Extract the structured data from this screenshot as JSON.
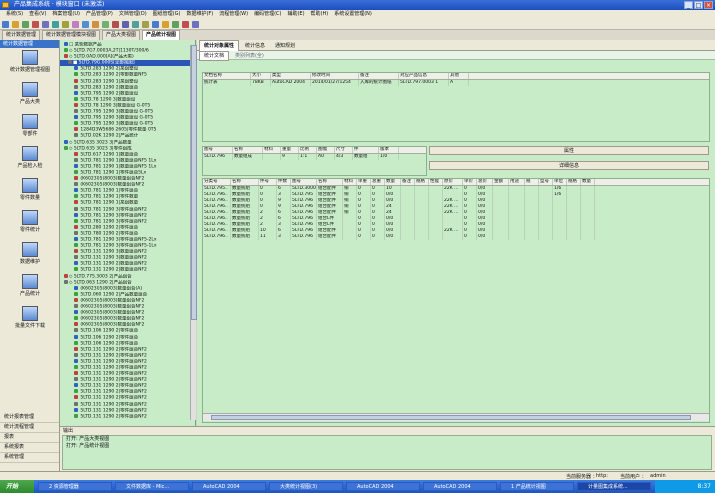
{
  "window": {
    "title": "产品集成系统 · 模块窗口 (未激活)",
    "icon": "app-icon"
  },
  "menu": [
    "系统(S)",
    "查看(V)",
    "档案管理(U)",
    "产品管理(P)",
    "文档管理(D)",
    "图纸管理(G)",
    "数据维护(F)",
    "流程管理(W)",
    "编码管理(C)",
    "辅助(E)",
    "帮助(H)",
    "系统设置管理(N)"
  ],
  "doc_tabs": [
    {
      "label": "统计数据管理"
    },
    {
      "label": "统计数据管理模块视图"
    },
    {
      "label": "产品大类视图"
    },
    {
      "label": "产品统计视图",
      "active": true
    }
  ],
  "left_panel": {
    "header": "统计数据管理",
    "items": [
      "统计数据管理视图",
      "产品大类",
      "零部件",
      "产品检入检",
      "零件数量",
      "零件统计",
      "数据维护",
      "产品统计",
      "批量文件下载"
    ],
    "bottom": [
      "统计报表管理",
      "统计流程管理",
      "报表",
      "系统报表",
      "系统管理"
    ]
  },
  "tree": {
    "rows": [
      "□ 某些数据产品",
      "◇ 5LTD.7G7.0003A,2T|1130T/300/6",
      "◇ 5LTD.0AD.000[A](产品大类)",
      "■ 5LTD.79G.000S[全部视图]",
      "  5LTD.283 1290 2|某组整设",
      "  5LTD.283 1290 2|零部数量NF5",
      "  5LTD.283 1290 1|某组整设",
      "  5LTD.283 1290 2|数量组合",
      "  5LTD.795 1290 2|数量组设",
      "  5LTD.78 1290 3|数量组设",
      "  5LTD.78 1290 3|数量组设 G-0T5",
      "  5LTD.795 1290 3|数量组设 G-0T5",
      "  5LTD.795 1290 3|数量组设 G-0T5",
      "  5LTD.795 1290 3|数量组设 G-0T5",
      "  1284D3W5686 2605|零件数量 0T5",
      "  5LTD.02K 1290 2|产品统计",
      "◇ 5LTD.635 3023 3|产品数量",
      "◇ 5LTD.635 3023 3|零件组成",
      "  5LTD.617 1290 1|数量组合",
      "  5LTD.781 1290 1|数量组合NF5 1Lx",
      "  5LTD.781 1290 1|数量组合NF5 1Lx",
      "  5LTD.781 1290 1|零件组合5Lx",
      "  (K6023I)5(8003)数量组合NF2",
      "  (K6023I)5(8003)数量组合NF2",
      "  5LTD.781 1290 1|零件组合",
      "  5LTD.781 1290 1|零件数量",
      "  5LTD.781 1290 1|某组数量",
      "  5LTD.781 1290 3|零件组合NF2",
      "  5LTD.781 1290 3|零件组合NF2",
      "  5LTD.781 1290 3|零件组合NF2",
      "  5LTD.280 1290 2|零件组合",
      "  5LTD.780 1290 2|零件组合",
      "  5LTD.781 1290 3|零件组合NF5-2Lx",
      "  5LTD.781 1290 3|零件组合NF5-1Lx",
      "  5LTD.131 1290 3|数量组合NF2",
      "  5LTD.131 1290 3|数量组合NF2",
      "  5LTD.131 1290 2|数量组合NF2",
      "  5LTD.131 1290 2|数量组合NF2",
      "◇ 5LTD.775.3003 2|产品组合",
      "◇ 5LTD.063 1290 2|产品组合",
      "  (K6023I)5(8003)数量组合(A)",
      "  5LTD.060 1290 2|产品数量组合",
      "  (K6023I)5(8003)数量组合NF2",
      "  (K6023I)5(8003)数量组合NF2",
      "  (K6023I)5(8003)数量组合NF2",
      "  (K6023I)5(8003)数量组合NF2",
      "  (K6023I)5(8003)数量组合NF2",
      "  5LTD.106 1290 2|零件组合",
      "  5LTD.106 1290 2|零件组合",
      "  5LTD.106 1290 2|零件组合",
      "  5LTD.131 1290 2|零件组合NF2",
      "  5LTD.131 1290 2|零件组合NF2",
      "  5LTD.131 1290 2|零件组合NF2",
      "  5LTD.131 1290 2|零件组合NF2",
      "  5LTD.131 1290 2|零件组合NF2",
      "  5LTD.131 1290 2|零件组合NF2",
      "  5LTD.131 1290 2|零件组合NF2",
      "  5LTD.131 1290 2|零件组合NF2",
      "  5LTD.131 1290 2|零件组合NF2",
      "  5LTD.131 1290 2|零件组合NF2",
      "  5LTD.131 1290 2|零件组合NF2",
      "  5LTD.131 1290 2|零件组合NF2"
    ]
  },
  "main_tabs": [
    {
      "label": "统计对象属性",
      "active": true
    },
    {
      "label": "统计信息"
    },
    {
      "label": "通知规划"
    }
  ],
  "sub_tab": "统计文档",
  "sub_tab_right": "类别列表(全)",
  "top_grid": {
    "headers": [
      "文档名称",
      "大小",
      "类型",
      "修改时间",
      "备注",
      "对应产品信息",
      "其他"
    ],
    "rows": [
      [
        "统计表",
        "78KB",
        "AutoCAD 2004",
        "2014/01/27/1254",
        "入库的统计图纸",
        "5LTD.797.0003 1",
        "A"
      ]
    ]
  },
  "mid_grid": {
    "headers": [
      "图号",
      "名称",
      "材料",
      "重量",
      "比例",
      "图幅",
      "尺寸",
      "件",
      "版本"
    ],
    "rows": [
      [
        "5LTD.796",
        "数量组成",
        "",
        "9",
        "1:1",
        "A0",
        "4/3",
        "数量组",
        "1/0"
      ]
    ]
  },
  "buttons": {
    "properties": "属性",
    "detail": "详细信息"
  },
  "detail_grid": {
    "headers": [
      "分类号",
      "名称",
      "件号",
      "件数",
      "图号",
      "名称",
      "材料",
      "单重",
      "总重",
      "数量",
      "备注",
      "规格",
      "性能",
      "原价",
      "单价",
      "总价",
      "金额",
      "用途",
      "规",
      "型号",
      "单位",
      "规格",
      "数量"
    ],
    "rows": [
      [
        "5LTD.795..",
        "数量统组",
        "0",
        "6",
        "5LTD.3000",
        "组合配件",
        "铜",
        "0",
        "0",
        "10",
        "",
        "",
        "",
        "22K ...",
        "0",
        "0/0",
        "",
        "",
        "",
        "",
        "1/6",
        "",
        ""
      ],
      [
        "5LTD.796..",
        "数量统组",
        "0",
        "3",
        "5LTD.795",
        "组合配件",
        "铜",
        "0",
        "0",
        "0/0",
        "",
        "",
        "",
        "",
        "0",
        "0/0",
        "",
        "",
        "",
        "",
        "1/6",
        "",
        ""
      ],
      [
        "5LTD.796..",
        "数量统组",
        "0",
        "9",
        "5LTD.796",
        "组合配件",
        "铜",
        "0",
        "0",
        "0/0",
        "",
        "",
        "",
        "22K ...",
        "0",
        "0/0",
        "",
        "",
        "",
        "",
        "",
        "",
        ""
      ],
      [
        "5LTD.796..",
        "数量统组",
        "0",
        "9",
        "5LTD.796",
        "组合配件",
        "铜",
        "0",
        "0",
        "24",
        "",
        "",
        "",
        "22K ...",
        "0",
        "0/0",
        "",
        "",
        "",
        "",
        "",
        "",
        ""
      ],
      [
        "5LTD.796..",
        "数量统组",
        "2",
        "6",
        "5LTD.796",
        "组合配件",
        "铜",
        "0",
        "0",
        "24",
        "",
        "",
        "",
        "22K ...",
        "0",
        "0/0",
        "",
        "",
        "",
        "",
        "",
        "",
        ""
      ],
      [
        "5LTD.796..",
        "数量统组",
        "2",
        "6",
        "5LTD.796",
        "组合L件",
        "",
        "0",
        "0",
        "0/0",
        "",
        "",
        "",
        "",
        "0",
        "0/0",
        "",
        "",
        "",
        "",
        "",
        "",
        ""
      ],
      [
        "5LTD.796..",
        "数量统组",
        "2",
        "3",
        "5LTD.796",
        "组合L件",
        "",
        "0",
        "0",
        "0/0",
        "",
        "",
        "",
        "",
        "0",
        "0/0",
        "",
        "",
        "",
        "",
        "",
        "",
        ""
      ],
      [
        "5LTD.796..",
        "数量统组",
        "10",
        "6",
        "5LTD.796",
        "组合配件",
        "",
        "0",
        "0",
        "0/0",
        "",
        "",
        "",
        "22K ...",
        "0",
        "0/0",
        "",
        "",
        "",
        "",
        "",
        "",
        ""
      ],
      [
        "5LTD.796..",
        "数量统组",
        "11",
        "3",
        "5LTD.796",
        "组合配件",
        "",
        "0",
        "0",
        "0/0",
        "",
        "",
        "",
        "",
        "0",
        "0/0",
        "",
        "",
        "",
        "",
        "",
        "",
        ""
      ]
    ]
  },
  "output": {
    "header": "输出",
    "lines": [
      "打开: 产品大类视图",
      "打开: 产品统计视图"
    ]
  },
  "status": {
    "right_label": "当前服务器 ：",
    "right_value": "http:",
    "user_label": "当前用户 ：",
    "user_value": "admin"
  },
  "taskbar": {
    "start": "开始",
    "tasks": [
      "2 资源管理器",
      "文件数据库 - Mic...",
      "AutoCAD 2004",
      "大类统计视图(3)",
      "AutoCAD 2004",
      "AutoCAD 2004",
      "1 产品统计视图",
      "计量图集成系统..."
    ],
    "clock": "8:37"
  }
}
